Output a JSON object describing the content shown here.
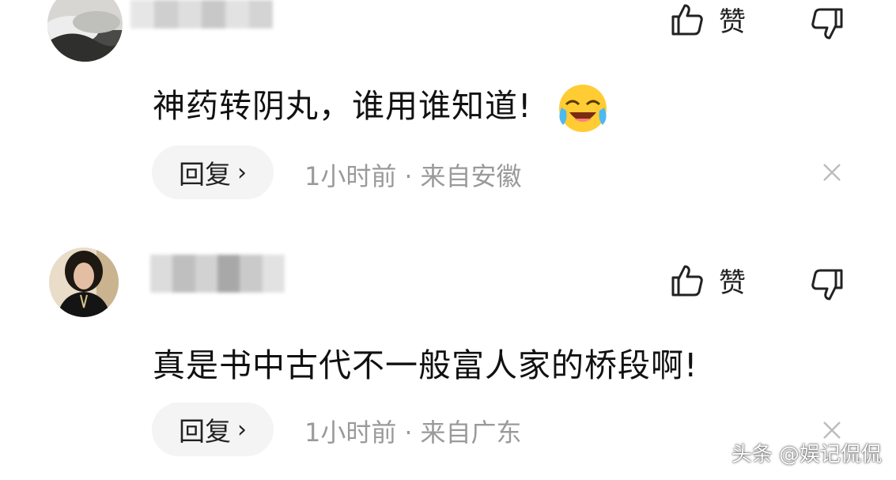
{
  "comments": [
    {
      "text": "神药转阴丸，谁用谁知道!",
      "like_label": "赞",
      "reply_label": "回复",
      "time": "1小时前",
      "separator": "·",
      "location": "来自安徽",
      "emoji": "laughing-crying-emoji"
    },
    {
      "text": "真是书中古代不一般富人家的桥段啊!",
      "like_label": "赞",
      "reply_label": "回复",
      "time": "1小时前",
      "separator": "·",
      "location": "来自广东"
    }
  ],
  "watermark": "头条 @娱记侃侃"
}
